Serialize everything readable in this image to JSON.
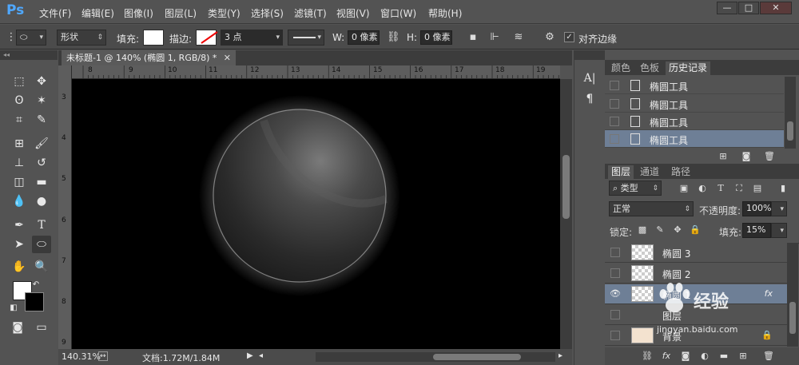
{
  "app": {
    "logo": "Ps"
  },
  "menu": [
    "文件(F)",
    "编辑(E)",
    "图像(I)",
    "图层(L)",
    "类型(Y)",
    "选择(S)",
    "滤镜(T)",
    "视图(V)",
    "窗口(W)",
    "帮助(H)"
  ],
  "window_controls": {
    "minimize": "—",
    "maximize": "□",
    "close": "✕"
  },
  "options": {
    "mode": "形状",
    "fill_label": "填充:",
    "stroke_label": "描边:",
    "stroke_width": "3 点",
    "w_label": "W:",
    "w_value": "0 像素",
    "h_label": "H:",
    "h_value": "0 像素",
    "align_edges_label": "对齐边缘",
    "align_edges_checked": true
  },
  "document": {
    "tab_title": "未标题-1 @ 140% (椭圆 1, RGB/8) *",
    "zoom": "140.31%",
    "doc_size": "文档:1.72M/1.84M",
    "ruler_h": [
      "8",
      "9",
      "10",
      "11",
      "12",
      "13",
      "14",
      "15",
      "16",
      "17",
      "18",
      "19"
    ],
    "ruler_v": [
      "3",
      "4",
      "5",
      "6",
      "7",
      "8",
      "9"
    ]
  },
  "history_panel": {
    "tabs": [
      "颜色",
      "色板",
      "历史记录"
    ],
    "active_tab": "历史记录",
    "items": [
      {
        "label": "椭圆工具",
        "selected": false
      },
      {
        "label": "椭圆工具",
        "selected": false
      },
      {
        "label": "椭圆工具",
        "selected": false
      },
      {
        "label": "椭圆工具",
        "selected": true
      }
    ]
  },
  "layers_panel": {
    "tabs": [
      "图层",
      "通道",
      "路径"
    ],
    "active_tab": "图层",
    "filter": "类型",
    "blend_mode": "正常",
    "opacity_label": "不透明度:",
    "opacity": "100%",
    "lock_label": "锁定:",
    "fill_label": "填充:",
    "fill": "15%",
    "layers": [
      {
        "name": "椭圆 3",
        "visible": false,
        "selected": false,
        "fx": false
      },
      {
        "name": "椭圆 2",
        "visible": false,
        "selected": false,
        "fx": false
      },
      {
        "name": "椭圆 1",
        "visible": true,
        "selected": true,
        "fx": true
      },
      {
        "name": "图层",
        "visible": false,
        "selected": false,
        "fx": false
      },
      {
        "name": "背景",
        "visible": false,
        "selected": false,
        "fx": false,
        "locked": true
      }
    ],
    "fx_symbol": "fx"
  },
  "watermark": {
    "text": "经验",
    "url": "jingyan.baidu.com"
  },
  "colors": {
    "ui": "#535353",
    "dark": "#3c3c3c",
    "selection": "#6e7f96",
    "accent": "#4fa8ff"
  }
}
